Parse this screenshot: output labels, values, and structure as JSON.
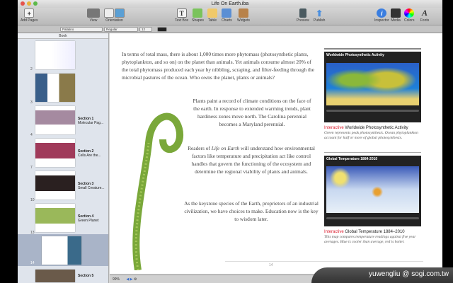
{
  "window": {
    "title": "Life On Earth.iba"
  },
  "toolbar": {
    "add_pages": "Add Pages",
    "view": "View",
    "orientation": "Orientation",
    "text_box": "Text Box",
    "shapes": "Shapes",
    "table": "Table",
    "charts": "Charts",
    "widgets": "Widgets",
    "preview": "Preview",
    "publish": "Publish",
    "inspector": "Inspector",
    "media": "Media",
    "colors": "Colors",
    "fonts": "Fonts"
  },
  "formatbar": {
    "font": "Palatino",
    "style": "Regular",
    "size": "12"
  },
  "sidebar": {
    "header": "Book",
    "pages": [
      {
        "num": "2"
      },
      {
        "num": "3"
      },
      {
        "num": "4",
        "section": "Section 1",
        "title": "Molecular Pag..."
      },
      {
        "num": "7",
        "section": "Section 2",
        "title": "Cells Are the..."
      },
      {
        "num": "10",
        "section": "Section 3",
        "title": "Small Creature..."
      },
      {
        "num": "13",
        "section": "Section 4",
        "title": "Green Planet"
      },
      {
        "num": "14"
      },
      {
        "num": "",
        "section": "Section 5",
        "title": ""
      }
    ]
  },
  "page": {
    "p1": "In terms of total mass, there is about 1,000 times more phytomass (photosynthetic plants, phytoplankton, and so on) on the planet than animals. Yet animals consume almost 20% of the total phytomass produced each year by nibbling, scraping, and filter-feeding through the microbial pastures of the ocean. Who owns the planet, plants or animals?",
    "p2": "Plants paint a record of climate conditions on the face of the earth. In response to extended warming trends, plant hardiness zones move north. The Carolina perennial becomes a Maryland perennial.",
    "p3a": "Readers of ",
    "p3i": "Life on Earth",
    "p3b": " will understand how environmental factors like temperature and precipitation act like control handles that govern the functioning of the ecosystem and determine the regional viability of plants and animals.",
    "p4": "As the keystone species of the Earth, proprietors of an industrial civilization, we have choices to make. Education now is the key to wisdom later.",
    "page_number": "14",
    "fig1": {
      "widget_title": "Worldwide Photosynthetic Activity",
      "tag": "Interactive",
      "title": "Worldwide Photosynthetic Activity",
      "caption": "Green represents peak photosynthesis. Ocean phytoplankton account for half or more of global photosynthesis."
    },
    "fig2": {
      "widget_title": "Global Temperature 1884-2010",
      "tag": "Interactive",
      "title": "Global Temperature 1884–2010",
      "caption": "This map compares temperature readings against five year averages. Blue is cooler than average, red is hotter."
    }
  },
  "status": {
    "zoom": "99%"
  },
  "watermark": "yuwengliu  @ sogi.com.tw"
}
